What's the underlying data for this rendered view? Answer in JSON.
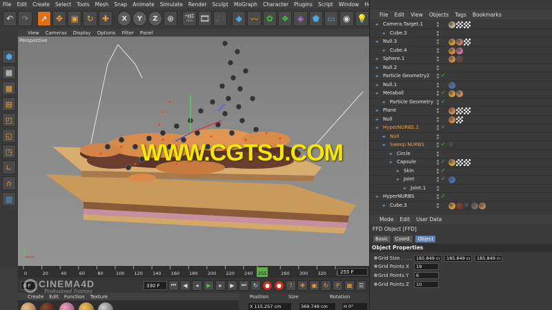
{
  "menu": [
    "File",
    "Edit",
    "Create",
    "Select",
    "Tools",
    "Mesh",
    "Snap",
    "Animate",
    "Simulate",
    "Render",
    "Sculpt",
    "MoGraph",
    "Character",
    "Plugins",
    "Script",
    "Window",
    "Help"
  ],
  "toolbar_axes": [
    "X",
    "Y",
    "Z"
  ],
  "viewport_menu": [
    "View",
    "Cameras",
    "Display",
    "Options",
    "Filter",
    "Panel"
  ],
  "viewport": {
    "label": "Perspective",
    "watermark": "WWW.CGTSJ.COM"
  },
  "timeline": {
    "ticks": [
      "0",
      "20",
      "40",
      "60",
      "80",
      "100",
      "120",
      "140",
      "160",
      "180",
      "200",
      "220",
      "240",
      "255",
      "280",
      "300",
      "320",
      "340"
    ],
    "current_frame": "255",
    "end_frame": "255 F"
  },
  "transport": {
    "start_frame": "0 F",
    "max_frame": "330 F"
  },
  "logo": {
    "line1": "CINEMA4D",
    "line2": "Professional Training"
  },
  "material_menu": [
    "Create",
    "Edit",
    "Function",
    "Texture"
  ],
  "coordinates": {
    "headers": [
      "Position",
      "Size",
      "Rotation"
    ],
    "position_x": "X  115.257 cm",
    "size_x": "369.749 cm",
    "rotation_h": "H  0°"
  },
  "object_manager": {
    "menu": [
      "File",
      "Edit",
      "View",
      "Objects",
      "Tags",
      "Bookmarks"
    ],
    "objects": [
      {
        "name": "Camera.Target.1",
        "indent": 0,
        "orange": false,
        "check": false,
        "tags": [
          "#c8b898",
          "chk",
          "chk"
        ]
      },
      {
        "name": "Cube.3",
        "indent": 1,
        "orange": false,
        "check": false,
        "tags": []
      },
      {
        "name": "Null.3",
        "indent": 0,
        "orange": false,
        "check": false,
        "tags": [
          "#e0a030",
          "#d08060",
          "chk"
        ]
      },
      {
        "name": "Cube.4",
        "indent": 1,
        "orange": false,
        "check": false,
        "tags": [
          "#e09040",
          "#d870a0"
        ]
      },
      {
        "name": "Sphere.1",
        "indent": 0,
        "orange": false,
        "check": false,
        "tags": [
          "#e09040",
          "#6a4030"
        ]
      },
      {
        "name": "Null.2",
        "indent": 0,
        "orange": false,
        "check": false,
        "tags": []
      },
      {
        "name": "Particle Geometry2",
        "indent": 0,
        "orange": false,
        "check": true,
        "tags": []
      },
      {
        "name": "Null.1",
        "indent": 0,
        "orange": false,
        "check": false,
        "tags": [
          "#5070c0"
        ]
      },
      {
        "name": "Metaball",
        "indent": 0,
        "orange": false,
        "check": true,
        "tags": [
          "#e0a030",
          "#d09060"
        ]
      },
      {
        "name": "Particle Geometry",
        "indent": 1,
        "orange": false,
        "check": true,
        "tags": []
      },
      {
        "name": "Plane",
        "indent": 0,
        "orange": false,
        "check": false,
        "tags": [
          "#e09040",
          "chk",
          "chk"
        ]
      },
      {
        "name": "Null",
        "indent": 0,
        "orange": false,
        "check": false,
        "tags": [
          "#e09040",
          "chk"
        ]
      },
      {
        "name": "HyperNURBS.1",
        "indent": 0,
        "orange": true,
        "check": true,
        "tags": []
      },
      {
        "name": "Null",
        "indent": 1,
        "orange": true,
        "check": false,
        "tags": []
      },
      {
        "name": "Sweep NURBS",
        "indent": 1,
        "orange": true,
        "check": true,
        "tags": [
          "#3a3030"
        ]
      },
      {
        "name": "Circle",
        "indent": 2,
        "orange": false,
        "check": false,
        "tags": []
      },
      {
        "name": "Capsule",
        "indent": 2,
        "orange": false,
        "check": true,
        "tags": [
          "#e0a030",
          "chk",
          "chk"
        ]
      },
      {
        "name": "Skin",
        "indent": 3,
        "orange": false,
        "check": true,
        "tags": []
      },
      {
        "name": "Joint",
        "indent": 3,
        "orange": false,
        "check": true,
        "tags": [
          "#5070c0"
        ]
      },
      {
        "name": "Joint.1",
        "indent": 4,
        "orange": false,
        "check": false,
        "tags": []
      },
      {
        "name": "HyperNURBS",
        "indent": 0,
        "orange": false,
        "check": true,
        "tags": []
      },
      {
        "name": "Cube.3",
        "indent": 1,
        "orange": false,
        "check": false,
        "tags": [
          "#e0a030",
          "#8a3020",
          "#303030",
          "#707070",
          "#d08040"
        ]
      }
    ]
  },
  "attribute_manager": {
    "menu": [
      "Mode",
      "Edit",
      "User Data"
    ],
    "title": "FFD Object [FFD]",
    "tabs": [
      "Basic",
      "Coord.",
      "Object"
    ],
    "active_tab": "Object",
    "section": "Object Properties",
    "grid_size_label": "Grid Size . . . .",
    "grid_size": [
      "185.849 cı",
      "185.849 cı",
      "185.849 cı"
    ],
    "grid_points": [
      {
        "label": "Grid Points X",
        "value": "19"
      },
      {
        "label": "Grid Points Y",
        "value": "6"
      },
      {
        "label": "Grid Points Z",
        "value": "10"
      }
    ]
  },
  "colors": {
    "accent": "#e07018",
    "watermark": "#f6e600",
    "selected_object": "#f2a040"
  }
}
